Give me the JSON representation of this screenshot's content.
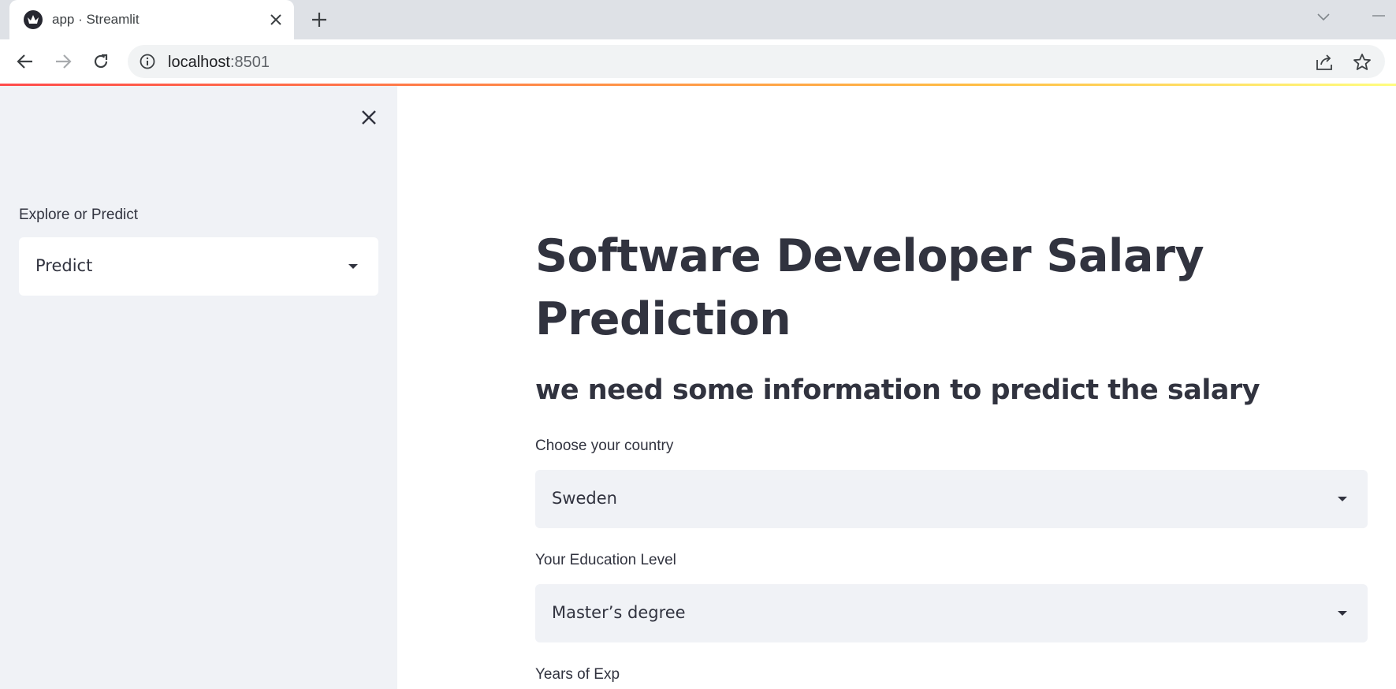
{
  "browser": {
    "tab_title": "app · Streamlit",
    "url_host": "localhost",
    "url_port": ":8501"
  },
  "colors": {
    "sidebar_bg": "#f0f2f6",
    "text": "#31333f",
    "accent_gradient_start": "#ff4b4b",
    "accent_gradient_end": "#fffd80"
  },
  "sidebar": {
    "select_label": "Explore or Predict",
    "select_value": "Predict"
  },
  "main": {
    "title": "Software Developer Salary Prediction",
    "subheader": "we need some information to predict the salary",
    "country_label": "Choose your country",
    "country_value": "Sweden",
    "education_label": "Your Education Level",
    "education_value": "Master’s degree",
    "experience_label": "Years of Exp"
  }
}
